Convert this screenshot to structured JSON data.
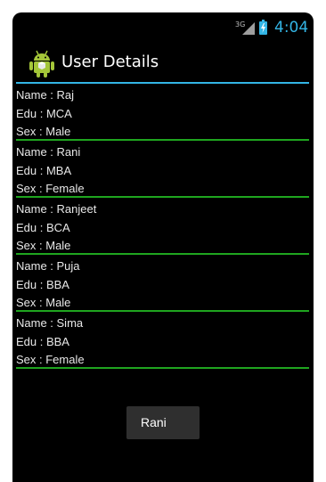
{
  "status_bar": {
    "network_type": "3G",
    "time": "4:04",
    "signal_icon": "signal-icon",
    "battery_icon": "battery-charging-icon"
  },
  "action_bar": {
    "title": "User Details",
    "app_icon": "android-icon"
  },
  "users": [
    {
      "name": "Name : Raj",
      "edu": "Edu : MCA",
      "sex": "Sex : Male"
    },
    {
      "name": "Name : Rani",
      "edu": "Edu : MBA",
      "sex": "Sex : Female"
    },
    {
      "name": "Name : Ranjeet",
      "edu": "Edu : BCA",
      "sex": "Sex : Male"
    },
    {
      "name": "Name : Puja",
      "edu": "Edu : BBA",
      "sex": "Sex : Male"
    },
    {
      "name": "Name : Sima",
      "edu": "Edu : BBA",
      "sex": "Sex : Female"
    }
  ],
  "button": {
    "label": "Rani"
  },
  "colors": {
    "accent": "#33b5e5",
    "divider": "#1fa51f",
    "background": "#000000",
    "android_green": "#a4c639"
  }
}
